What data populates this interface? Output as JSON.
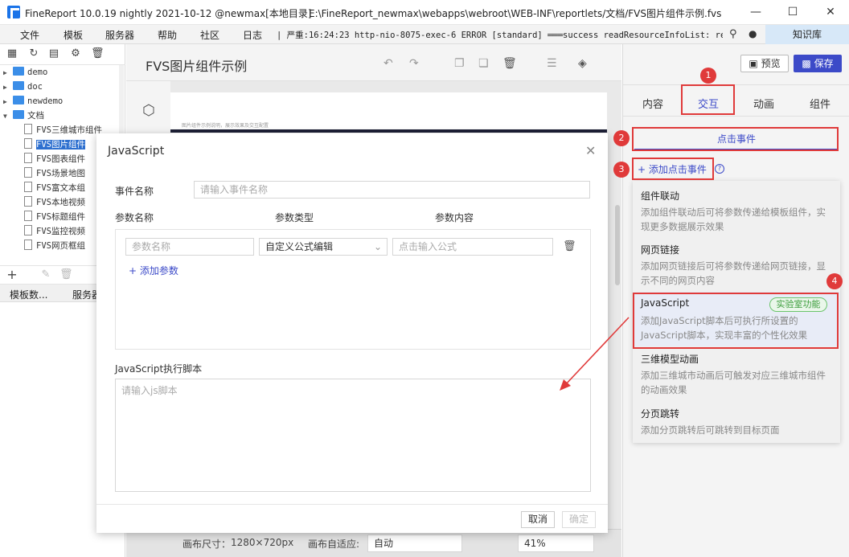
{
  "window": {
    "title": "FineReport 10.0.19 nightly 2021-10-12 @newmax[本地目录]",
    "path": "E:\\FineReport_newmax\\webapps\\webroot\\WEB-INF\\reportlets/文档/FVS图片组件示例.fvs",
    "min": "—",
    "max": "☐",
    "close": "✕"
  },
  "menubar": {
    "items": [
      "文件",
      "模板",
      "服务器",
      "帮助",
      "社区"
    ],
    "log_label": "日志",
    "log_text": "| 严重:16:24:23 http-nio-8075-exec-6 ERROR [standard] ═══success readResourceInfoList: rep...",
    "knowledge": "知识库"
  },
  "tree": {
    "items": [
      {
        "label": "demo",
        "type": "folder",
        "level": 0
      },
      {
        "label": "doc",
        "type": "folder",
        "level": 0
      },
      {
        "label": "newdemo",
        "type": "folder",
        "level": 0
      },
      {
        "label": "文档",
        "type": "folder",
        "level": 0,
        "open": true
      },
      {
        "label": "FVS三维城市组件",
        "type": "file",
        "level": 1
      },
      {
        "label": "FVS图片组件",
        "type": "file",
        "level": 1,
        "selected": true
      },
      {
        "label": "FVS图表组件",
        "type": "file",
        "level": 1
      },
      {
        "label": "FVS场景地图",
        "type": "file",
        "level": 1
      },
      {
        "label": "FVS富文本组",
        "type": "file",
        "level": 1
      },
      {
        "label": "FVS本地视频",
        "type": "file",
        "level": 1
      },
      {
        "label": "FVS标题组件",
        "type": "file",
        "level": 1
      },
      {
        "label": "FVS监控视频",
        "type": "file",
        "level": 1
      },
      {
        "label": "FVS网页框组",
        "type": "file",
        "level": 1
      }
    ]
  },
  "left_tabs": [
    "模板数...",
    "服务器"
  ],
  "editor": {
    "title": "FVS图片组件示例",
    "canvas_caption": "图片组件示例说明，展示效果及交互配置",
    "footer": {
      "size_label": "画布尺寸：",
      "size_value": "1280×720px",
      "adapt_label": "画布自适应:",
      "adapt_value": "自动",
      "zoom": "41%"
    }
  },
  "right": {
    "preview": "预览",
    "save": "保存",
    "tabs": [
      "内容",
      "交互",
      "动画",
      "组件"
    ],
    "active_tab": "交互",
    "click_event": "点击事件",
    "add_click": "添加点击事件",
    "menu": [
      {
        "title": "组件联动",
        "desc": "添加组件联动后可将参数传递给模板组件，实现更多数据展示效果"
      },
      {
        "title": "网页链接",
        "desc": "添加网页链接后可将参数传递给网页链接，显示不同的网页内容"
      },
      {
        "title": "JavaScript",
        "desc": "添加JavaScript脚本后可执行所设置的JavaScript脚本，实现丰富的个性化效果",
        "badge": "实验室功能"
      },
      {
        "title": "三维模型动画",
        "desc": "添加三维城市动画后可触发对应三维城市组件的动画效果"
      },
      {
        "title": "分页跳转",
        "desc": "添加分页跳转后可跳转到目标页面"
      }
    ]
  },
  "dialog": {
    "title": "JavaScript",
    "event_name_label": "事件名称",
    "event_name_placeholder": "请输入事件名称",
    "param_name_label": "参数名称",
    "param_type_label": "参数类型",
    "param_content_label": "参数内容",
    "param_name_placeholder": "参数名称",
    "param_type_value": "自定义公式编辑",
    "param_content_placeholder": "点击输入公式",
    "add_param": "添加参数",
    "script_label": "JavaScript执行脚本",
    "script_placeholder": "请输入js脚本",
    "cancel": "取消",
    "ok": "确定"
  },
  "annotations": [
    "1",
    "2",
    "3",
    "4"
  ],
  "colors": {
    "accent": "#3c4ac8",
    "annotation": "#e03a3a",
    "lab": "#3a9c3a"
  }
}
